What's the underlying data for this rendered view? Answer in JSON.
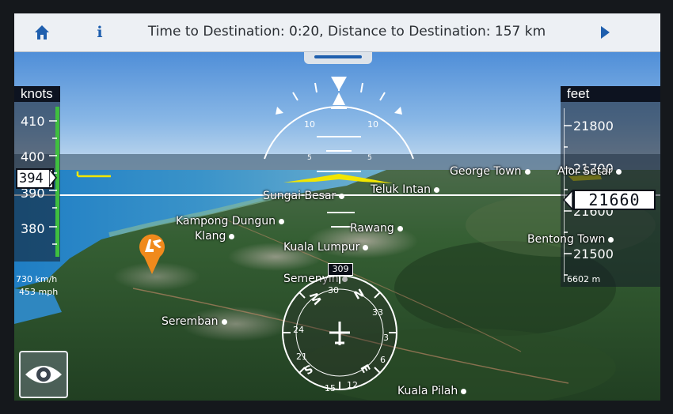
{
  "top_bar": {
    "destination_text": "Time to Destination: 0:20, Distance to Destination: 157 km",
    "icons": [
      "home-icon",
      "info-icon",
      "next-arrow-icon"
    ],
    "info_label": "i",
    "accent_color": "#1f5fae"
  },
  "speed_tape": {
    "unit": "knots",
    "ticks": [
      "410",
      "400",
      "390",
      "380"
    ],
    "current": "394",
    "ground_speed_kmh": "730 km/h",
    "ground_speed_mph": "453 mph"
  },
  "altitude_tape": {
    "unit": "feet",
    "ticks": [
      "21800",
      "21700",
      "21600",
      "21500"
    ],
    "current": "21660",
    "altitude_m": "6602 m"
  },
  "pitch_ladder": {
    "labels_10": [
      "10",
      "10"
    ],
    "labels_5": [
      "5",
      "5"
    ]
  },
  "compass": {
    "heading_box": "309",
    "cardinals": [
      "N",
      "E",
      "S",
      "W"
    ],
    "numbers": [
      "33",
      "3",
      "6",
      "12",
      "15",
      "21",
      "24",
      "30"
    ]
  },
  "places": [
    "George Town",
    "Alor Setar",
    "Sungai Besar",
    "Teluk Intan",
    "Kampong Dungun",
    "Rawang",
    "Klang",
    "Kuala Lumpur",
    "Bentong Town",
    "Semenyih",
    "Seremban",
    "Kuala Pilah"
  ],
  "colors": {
    "speed_bar": "#3fbf3f",
    "horizon_marker": "#f2e600",
    "poi_pin": "#f08a1c"
  }
}
